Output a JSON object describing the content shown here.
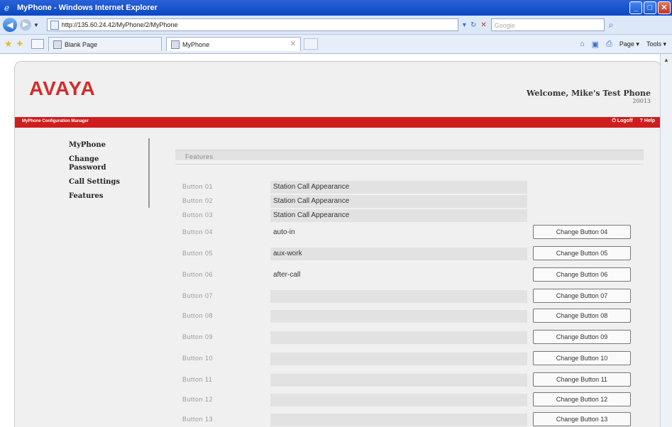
{
  "window": {
    "title": "MyPhone - Windows Internet Explorer",
    "controls": [
      "_",
      "□",
      "✕"
    ]
  },
  "address_bar": {
    "url": "http://135.60.24.42/MyPhone/2/MyPhone",
    "search_placeholder": "Google"
  },
  "tabs": [
    {
      "label": "Blank Page"
    },
    {
      "label": "MyPhone"
    }
  ],
  "toolbar": {
    "page_label": "Page",
    "tools_label": "Tools"
  },
  "header": {
    "logo": "AVAYA",
    "welcome": "Welcome, Mike's Test Phone",
    "extension": "20013",
    "app_name": "MyPhone Configuration Manager",
    "logoff": "Logoff",
    "help": "Help"
  },
  "sidebar": {
    "items": [
      {
        "label": "MyPhone"
      },
      {
        "label": "Change Password"
      },
      {
        "label": "Call Settings"
      },
      {
        "label": "Features"
      }
    ]
  },
  "features": {
    "title": "Features",
    "rows": [
      {
        "label": "Button 01",
        "value": "Station Call Appearance",
        "action": ""
      },
      {
        "label": "Button 02",
        "value": "Station Call Appearance",
        "action": ""
      },
      {
        "label": "Button 03",
        "value": "Station Call Appearance",
        "action": ""
      },
      {
        "label": "Button 04",
        "value": "auto-in",
        "action": "Change Button 04"
      },
      {
        "label": "Button 05",
        "value": "aux-work",
        "action": "Change Button 05"
      },
      {
        "label": "Button 06",
        "value": "after-call",
        "action": "Change Button 06"
      },
      {
        "label": "Button 07",
        "value": "",
        "action": "Change Button 07"
      },
      {
        "label": "Button 08",
        "value": "",
        "action": "Change Button 08"
      },
      {
        "label": "Button 09",
        "value": "",
        "action": "Change Button 09"
      },
      {
        "label": "Button 10",
        "value": "",
        "action": "Change Button 10"
      },
      {
        "label": "Button 11",
        "value": "",
        "action": "Change Button 11"
      },
      {
        "label": "Button 12",
        "value": "",
        "action": "Change Button 12"
      },
      {
        "label": "Button 13",
        "value": "",
        "action": "Change Button 13"
      }
    ]
  },
  "colors": {
    "brand_red": "#d42b2b",
    "header_bar": "#cf1d1d",
    "titlebar_blue": "#0b48c4"
  }
}
